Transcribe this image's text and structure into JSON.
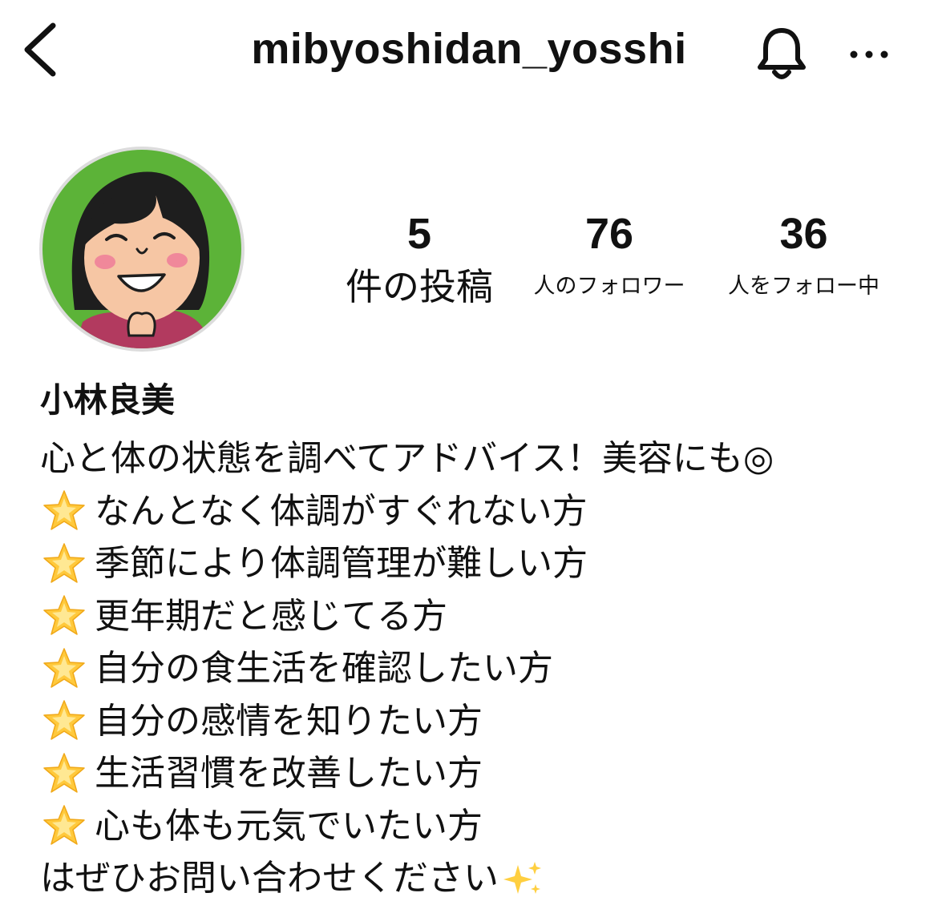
{
  "header": {
    "username": "mibyoshidan_yosshi",
    "back_icon": "chevron-left-icon",
    "bell_icon": "bell-icon",
    "more_icon": "more-horizontal-icon"
  },
  "profile": {
    "avatar_icon": "avatar-illustration",
    "stats": {
      "posts": {
        "value": "5",
        "label": "件の投稿"
      },
      "followers": {
        "value": "76",
        "label": "人のフォロワー"
      },
      "following": {
        "value": "36",
        "label": "人をフォロー中"
      }
    },
    "display_name": "小林良美",
    "bio": {
      "intro": "心と体の状態を調べてアドバイス！美容にも◎",
      "items": [
        "なんとなく体調がすぐれない方",
        "季節により体調管理が難しい方",
        "更年期だと感じてる方",
        "自分の食生活を確認したい方",
        "自分の感情を知りたい方",
        "生活習慣を改善したい方",
        "心も体も元気でいたい方"
      ],
      "closing": "はぜひお問い合わせください",
      "item_icon": "star-icon",
      "closing_icon": "sparkles-icon"
    }
  },
  "colors": {
    "text": "#111111",
    "avatar_background": "#5cb338",
    "avatar_ring": "#dcdcdc",
    "star": "#ffc93c"
  }
}
